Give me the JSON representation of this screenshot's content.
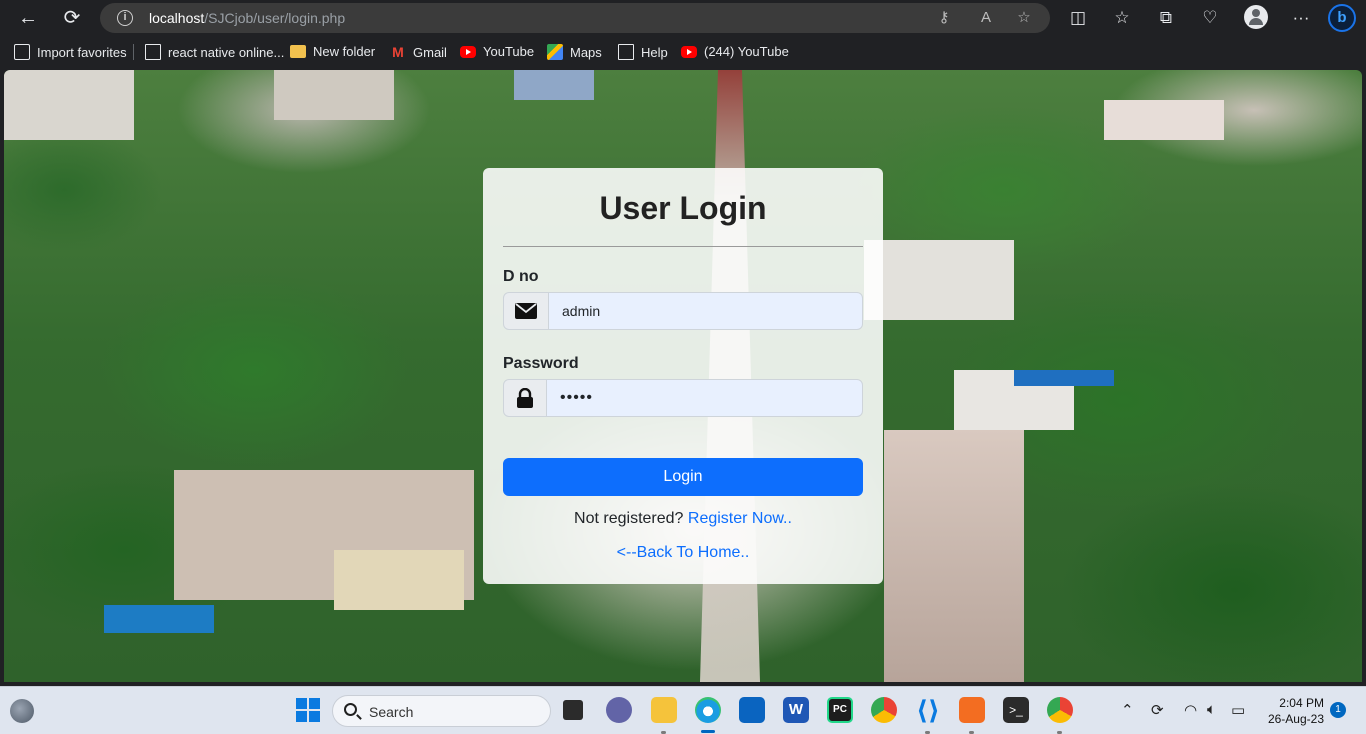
{
  "browser": {
    "url_host": "localhost",
    "url_path": "/SJCjob/user/login.php",
    "favorites": [
      {
        "label": "Import favorites",
        "icon": "import-icon"
      },
      {
        "label": "react native online...",
        "icon": "page-icon"
      },
      {
        "label": "New folder",
        "icon": "folder-icon"
      },
      {
        "label": "Gmail",
        "icon": "gmail-icon"
      },
      {
        "label": "YouTube",
        "icon": "youtube-icon"
      },
      {
        "label": "Maps",
        "icon": "maps-icon"
      },
      {
        "label": "Help",
        "icon": "page-icon"
      },
      {
        "label": "(244) YouTube",
        "icon": "youtube-icon"
      }
    ],
    "bing_label": "b"
  },
  "login": {
    "title": "User Login",
    "dno_label": "D no",
    "dno_value": "admin",
    "password_label": "Password",
    "password_value": "•••••",
    "login_button": "Login",
    "not_registered": "Not registered?",
    "register_link": "Register Now..",
    "back_link": "<--Back To Home.."
  },
  "taskbar": {
    "search_placeholder": "Search",
    "time": "2:04 PM",
    "date": "26-Aug-23",
    "notification_count": "1",
    "accent": "#0067c0"
  },
  "colors": {
    "primary": "#0d6efd",
    "field_bg": "#e8f0fe"
  }
}
